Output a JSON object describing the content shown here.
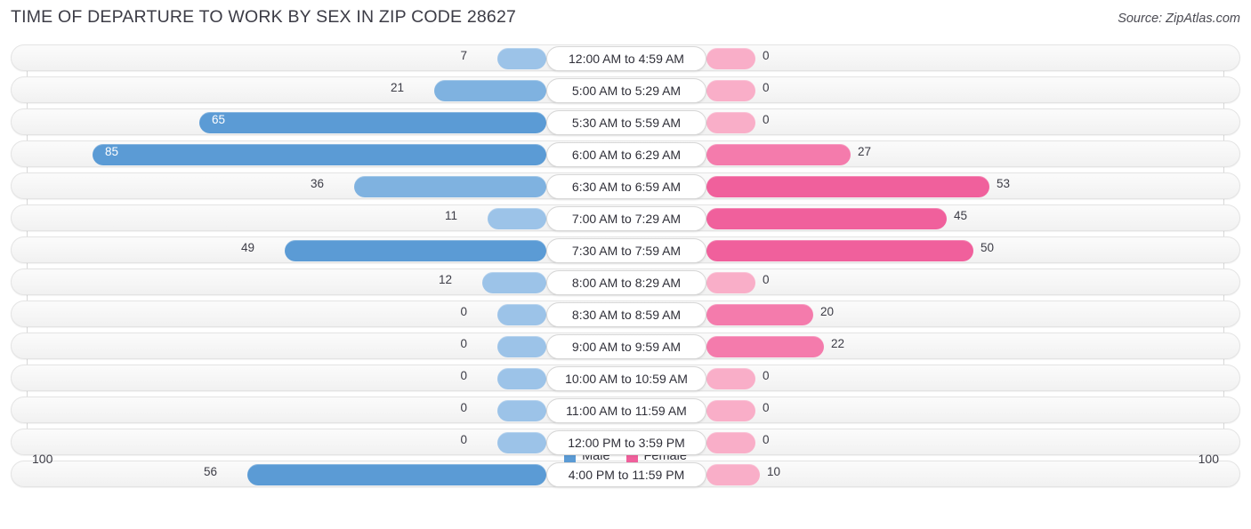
{
  "header": {
    "title": "TIME OF DEPARTURE TO WORK BY SEX IN ZIP CODE 28627",
    "source": "Source: ZipAtlas.com"
  },
  "legend": {
    "items": [
      {
        "label": "Male",
        "color": "#5B9BD5"
      },
      {
        "label": "Female",
        "color": "#F0609C"
      }
    ]
  },
  "axis": {
    "left_label": "100",
    "right_label": "100"
  },
  "chart_data": {
    "type": "bar",
    "subtype": "diverging-bidirectional",
    "title": "TIME OF DEPARTURE TO WORK BY SEX IN ZIP CODE 28627",
    "xlabel": "",
    "ylabel": "",
    "xlim": [
      100,
      100
    ],
    "grid": true,
    "legend_position": "bottom-center",
    "categories": [
      "12:00 AM to 4:59 AM",
      "5:00 AM to 5:29 AM",
      "5:30 AM to 5:59 AM",
      "6:00 AM to 6:29 AM",
      "6:30 AM to 6:59 AM",
      "7:00 AM to 7:29 AM",
      "7:30 AM to 7:59 AM",
      "8:00 AM to 8:29 AM",
      "8:30 AM to 8:59 AM",
      "9:00 AM to 9:59 AM",
      "10:00 AM to 10:59 AM",
      "11:00 AM to 11:59 AM",
      "12:00 PM to 3:59 PM",
      "4:00 PM to 11:59 PM"
    ],
    "series": [
      {
        "name": "Male",
        "color": "#5B9BD5",
        "direction": "left",
        "values": [
          7,
          21,
          65,
          85,
          36,
          11,
          49,
          12,
          0,
          0,
          0,
          0,
          0,
          56
        ]
      },
      {
        "name": "Female",
        "color": "#F0609C",
        "direction": "right",
        "values": [
          0,
          0,
          0,
          27,
          53,
          45,
          50,
          0,
          20,
          22,
          0,
          0,
          0,
          10
        ]
      }
    ]
  },
  "rows": [
    {
      "label": "12:00 AM to 4:59 AM",
      "male": "7",
      "female": "0",
      "male_v": 7,
      "female_v": 0
    },
    {
      "label": "5:00 AM to 5:29 AM",
      "male": "21",
      "female": "0",
      "male_v": 21,
      "female_v": 0
    },
    {
      "label": "5:30 AM to 5:59 AM",
      "male": "65",
      "female": "0",
      "male_v": 65,
      "female_v": 0
    },
    {
      "label": "6:00 AM to 6:29 AM",
      "male": "85",
      "female": "27",
      "male_v": 85,
      "female_v": 27
    },
    {
      "label": "6:30 AM to 6:59 AM",
      "male": "36",
      "female": "53",
      "male_v": 36,
      "female_v": 53
    },
    {
      "label": "7:00 AM to 7:29 AM",
      "male": "11",
      "female": "45",
      "male_v": 11,
      "female_v": 45
    },
    {
      "label": "7:30 AM to 7:59 AM",
      "male": "49",
      "female": "50",
      "male_v": 49,
      "female_v": 50
    },
    {
      "label": "8:00 AM to 8:29 AM",
      "male": "12",
      "female": "0",
      "male_v": 12,
      "female_v": 0
    },
    {
      "label": "8:30 AM to 8:59 AM",
      "male": "0",
      "female": "20",
      "male_v": 0,
      "female_v": 20
    },
    {
      "label": "9:00 AM to 9:59 AM",
      "male": "0",
      "female": "22",
      "male_v": 0,
      "female_v": 22
    },
    {
      "label": "10:00 AM to 10:59 AM",
      "male": "0",
      "female": "0",
      "male_v": 0,
      "female_v": 0
    },
    {
      "label": "11:00 AM to 11:59 AM",
      "male": "0",
      "female": "0",
      "male_v": 0,
      "female_v": 0
    },
    {
      "label": "12:00 PM to 3:59 PM",
      "male": "0",
      "female": "0",
      "male_v": 0,
      "female_v": 0
    },
    {
      "label": "4:00 PM to 11:59 PM",
      "male": "56",
      "female": "10",
      "male_v": 56,
      "female_v": 10
    }
  ]
}
